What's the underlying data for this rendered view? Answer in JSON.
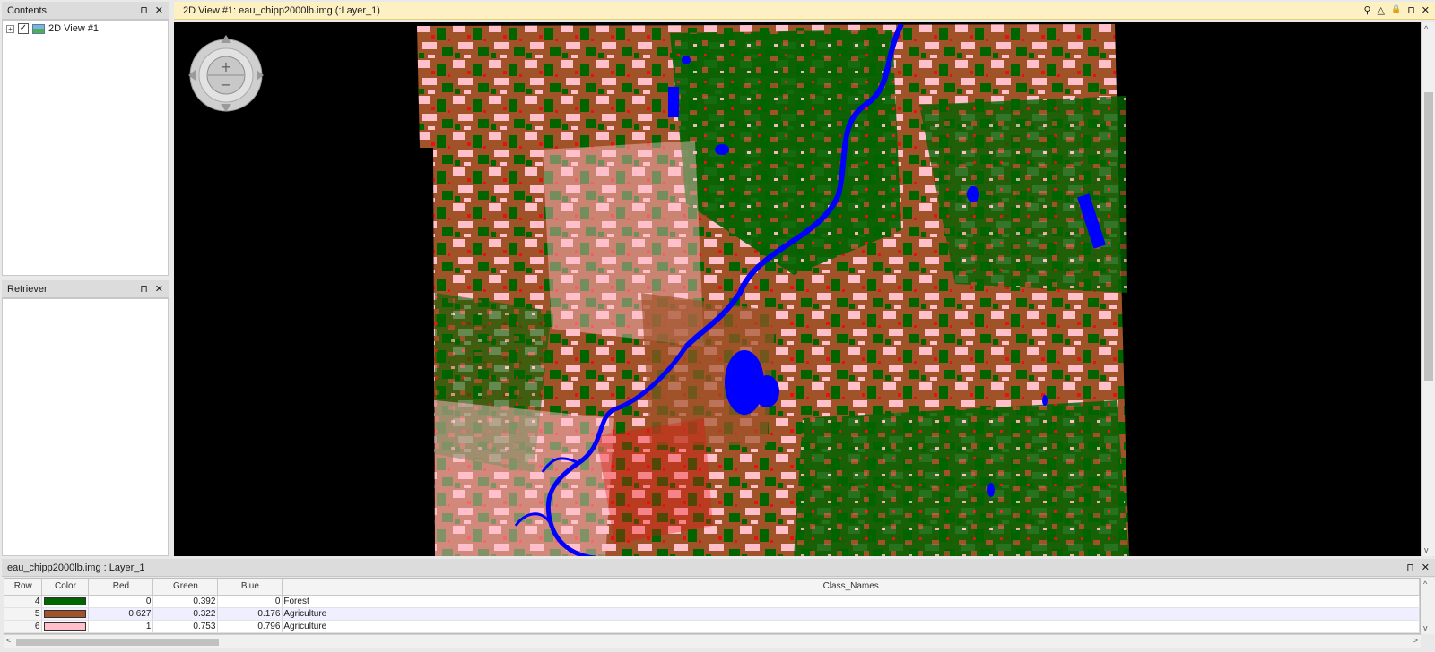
{
  "contents": {
    "title": "Contents",
    "pin_glyph": "⊓",
    "close_glyph": "✕",
    "tree": [
      {
        "expander": "+",
        "checked": "✓",
        "icon": "2d-view-icon",
        "label": "2D View #1"
      }
    ]
  },
  "retriever": {
    "title": "Retriever",
    "pin_glyph": "⊓",
    "close_glyph": "✕"
  },
  "view": {
    "title": "2D View #1: eau_chipp2000lb.img (:Layer_1)",
    "title_icons": [
      "link-icon",
      "warning-icon",
      "lock-icon",
      "pin-icon",
      "close-icon"
    ],
    "title_glyphs": [
      "⚲",
      "△",
      "🔒",
      "⊓",
      "✕"
    ],
    "nav": {
      "zoom_in": "+",
      "zoom_out": "−"
    },
    "colors": {
      "forest": "#006400",
      "agriculture_brown": "#a05229",
      "agriculture_pink": "#ffc0cb",
      "water": "#0000ff",
      "urban": "#e81010",
      "background": "#000000"
    }
  },
  "attribute_table": {
    "title": "eau_chipp2000lb.img : Layer_1",
    "pin_glyph": "⊓",
    "close_glyph": "✕",
    "columns": [
      "Row",
      "Color",
      "Red",
      "Green",
      "Blue",
      "Class_Names"
    ],
    "rows": [
      {
        "row": "4",
        "color": "#006400",
        "red": "0",
        "green": "0.392",
        "blue": "0",
        "class_name": "Forest"
      },
      {
        "row": "5",
        "color": "#a05229",
        "red": "0.627",
        "green": "0.322",
        "blue": "0.176",
        "class_name": "Agriculture"
      },
      {
        "row": "6",
        "color": "#ffc0cb",
        "red": "1",
        "green": "0.753",
        "blue": "0.796",
        "class_name": "Agriculture"
      }
    ],
    "scroll": {
      "left": "<",
      "right": ">",
      "up": "^",
      "down": "v"
    }
  }
}
